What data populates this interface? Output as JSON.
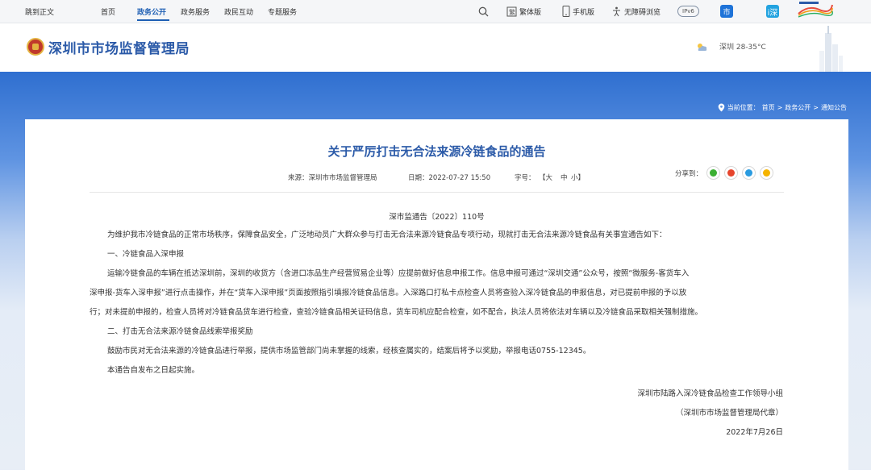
{
  "topbar": {
    "skip": "跳到正文",
    "nav": [
      "首页",
      "政务公开",
      "政务服务",
      "政民互动",
      "专题服务"
    ],
    "traditional": "繁体版",
    "mobile": "手机版",
    "accessible": "无障碍浏览",
    "ipv6": "IPv6",
    "app1": "市",
    "app2": "i深"
  },
  "header": {
    "agency": "深圳市市场监督管理局",
    "weather": "深圳 28-35°C"
  },
  "breadcrumb": {
    "label": "当前位置：",
    "items": [
      "首页",
      "政务公开",
      "通知公告"
    ],
    "sep": " > "
  },
  "article": {
    "title": "关于严厉打击无合法来源冷链食品的通告",
    "source": "来源：深圳市市场监督管理局",
    "date": "日期：2022-07-27 15:50",
    "font_label": "字号：",
    "font_sizes": [
      "【大",
      "中",
      "小】"
    ],
    "share_label": "分享到：",
    "doc_no": "深市监通告〔2022〕110号",
    "paragraphs": [
      "为维护我市冷链食品的正常市场秩序，保障食品安全，广泛地动员广大群众参与打击无合法来源冷链食品专项行动，现就打击无合法来源冷链食品有关事宜通告如下：",
      "一、冷链食品入深申报",
      "运输冷链食品的车辆在抵达深圳前，深圳的收货方（含进口冻品生产经营贸易企业等）应提前做好信息申报工作。信息申报可通过“深圳交通”公众号，按照“微服务-客货车入",
      "深申报-货车入深申报”进行点击操作，并在“货车入深申报”页面按照指引填报冷链食品信息。入深路口打私卡点检查人员将查验入深冷链食品的申报信息，对已提前申报的予以放",
      "行；对未提前申报的，检查人员将对冷链食品货车进行检查，查验冷链食品相关证码信息，货车司机应配合检查，如不配合，执法人员将依法对车辆以及冷链食品采取相关强制措施。",
      "二、打击无合法来源冷链食品线索举报奖励",
      "鼓励市民对无合法来源的冷链食品进行举报，提供市场监管部门尚未掌握的线索，经核查属实的，结案后将予以奖励，举报电话0755-12345。",
      "本通告自发布之日起实施。"
    ],
    "signature": [
      "深圳市陆路入深冷链食品检查工作领导小组",
      "（深圳市市场监督管理局代章）",
      "2022年7月26日"
    ]
  },
  "colors": {
    "brand_blue": "#2b5aa8",
    "nav_active": "#1e5fb4"
  },
  "icons": [
    "search-icon",
    "traditional-icon",
    "mobile-icon",
    "accessibility-icon",
    "wechat-icon",
    "weibo-icon",
    "qq-icon",
    "qzone-icon",
    "location-icon",
    "weather-icon"
  ]
}
